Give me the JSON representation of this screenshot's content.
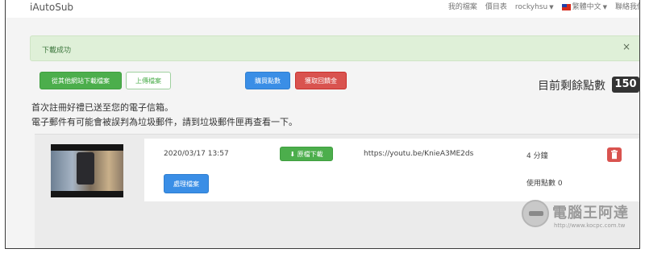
{
  "navbar": {
    "brand": "iAutoSub",
    "links": [
      "我的檔案",
      "價目表"
    ],
    "user": "rockyhsu",
    "language": "繁體中文",
    "contact": "聯絡我們"
  },
  "alert": {
    "message": "下載成功",
    "close": "×"
  },
  "actions": {
    "download_other": "從其他網站下載檔案",
    "upload": "上傳檔案",
    "buy_points": "購買點數",
    "get_refund": "獲取回饋金"
  },
  "points": {
    "label": "目前剩餘點數",
    "value": "150"
  },
  "notes": [
    "首次註冊好禮已送至您的電子信箱。",
    "電子郵件有可能會被誤判為垃圾郵件，請到垃圾郵件匣再查看一下。"
  ],
  "file": {
    "date": "2020/03/17 13:57",
    "download_label": "原檔下載",
    "url": "https://youtu.be/KnieA3ME2ds",
    "duration": "4 分鐘",
    "used_points": "使用點數 0",
    "process_label": "處理檔案"
  },
  "watermark": {
    "title": "電腦王阿達",
    "url": "http://www.kocpc.com.tw"
  },
  "colors": {
    "success_bg": "#dff0d8",
    "green": "#4cae4c",
    "blue": "#3a8ee6",
    "red": "#d9534f"
  }
}
